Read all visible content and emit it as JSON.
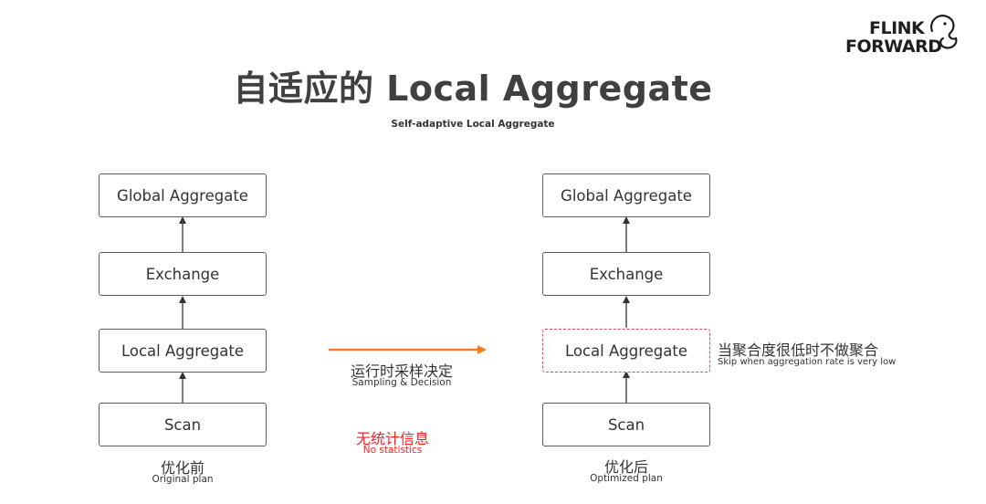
{
  "logo": {
    "line1": "FLINK",
    "line2": "FORWARD"
  },
  "title": "自适应的 Local Aggregate",
  "subtitle": "Self-adaptive Local Aggregate",
  "original_plan": {
    "boxes": [
      "Global Aggregate",
      "Exchange",
      "Local Aggregate",
      "Scan"
    ],
    "caption_cn": "优化前",
    "caption_en": "Original plan"
  },
  "optimized_plan": {
    "boxes": [
      "Global Aggregate",
      "Exchange",
      "Local Aggregate",
      "Scan"
    ],
    "caption_cn": "优化后",
    "caption_en": "Optimized plan",
    "skip_note_cn": "当聚合度很低时不做聚合",
    "skip_note_en": "Skip when aggregation rate is very low"
  },
  "transition": {
    "label_cn": "运行时采样决定",
    "label_en": "Sampling & Decision"
  },
  "no_stats": {
    "label_cn": "无统计信息",
    "label_en": "No statistics"
  },
  "colors": {
    "arrow_orange": "#ff7a1a",
    "dashed_red": "#e0484f",
    "note_red": "#ff2020"
  }
}
